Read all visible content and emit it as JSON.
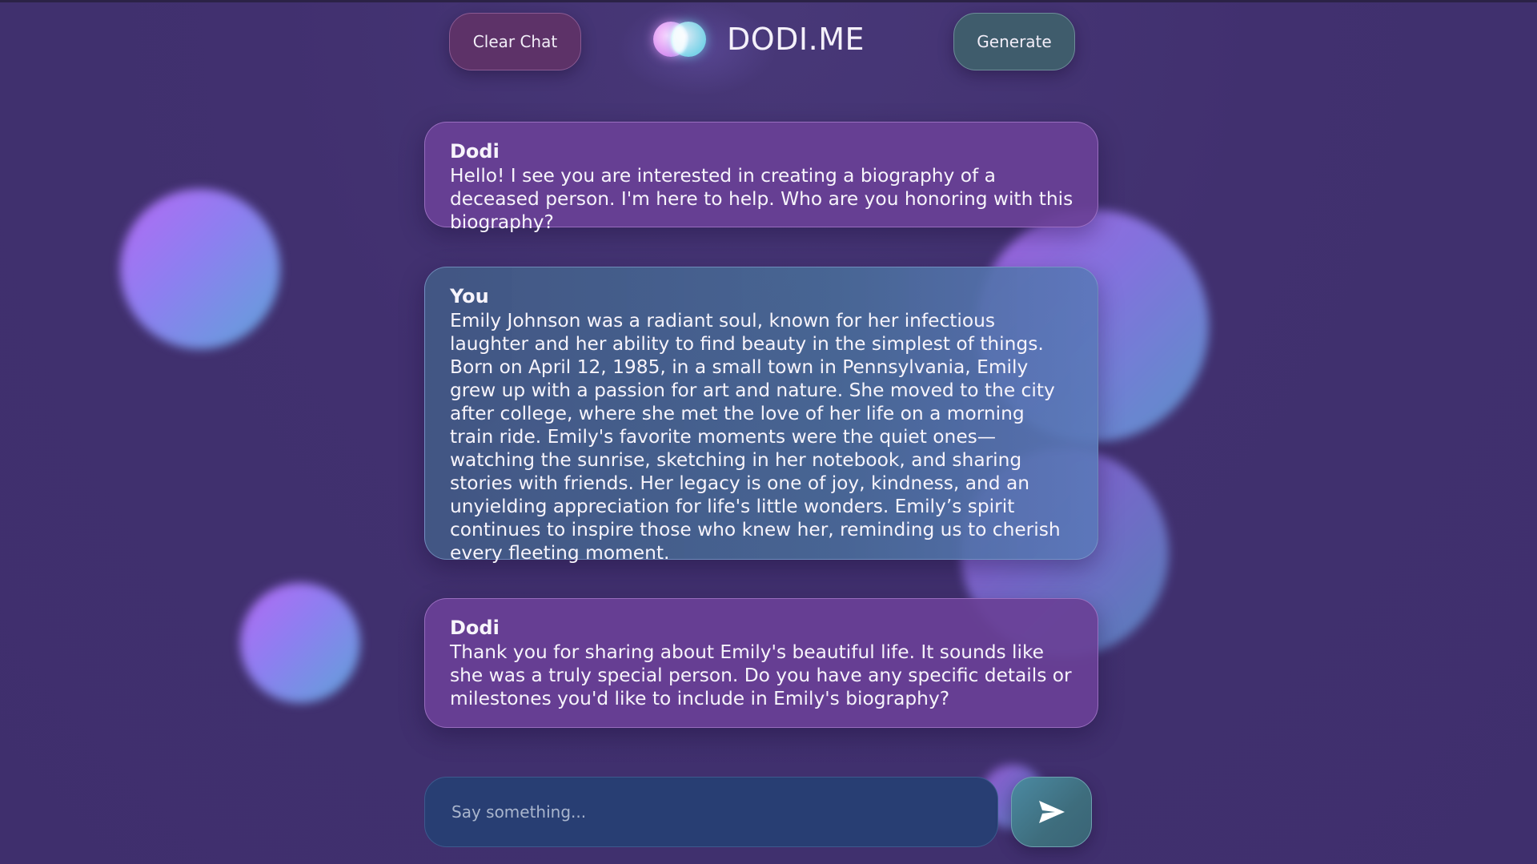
{
  "header": {
    "clear_label": "Clear Chat",
    "brand": "DODI.ME",
    "generate_label": "Generate"
  },
  "messages": [
    {
      "author": "Dodi",
      "text": "Hello! I see you are interested in creating a biography of a deceased person. I'm here to help. Who are you honoring with this biography?"
    },
    {
      "author": "You",
      "text": "Emily Johnson was a radiant soul, known for her infectious laughter and her ability to find beauty in the simplest of things. Born on April 12, 1985, in a small town in Pennsylvania, Emily grew up with a passion for art and nature. She moved to the city after college, where she met the love of her life on a morning train ride. Emily's favorite moments were the quiet ones—watching the sunrise, sketching in her notebook, and sharing stories with friends. Her legacy is one of joy, kindness, and an unyielding appreciation for life's little wonders. Emily’s spirit continues to inspire those who knew her, reminding us to cherish every fleeting moment."
    },
    {
      "author": "Dodi",
      "text": "Thank you for sharing about Emily's beautiful life. It sounds like she was a truly special person. Do you have any specific details or milestones you'd like to include in Emily's biography?"
    }
  ],
  "composer": {
    "placeholder": "Say something...",
    "value": ""
  },
  "icons": {
    "logo": "dodi-logo-icon",
    "send": "send-icon"
  },
  "colors": {
    "background": "#40306f",
    "dodi_bubble": "#694096",
    "user_bubble": "#425884",
    "clear_button": "#5d3268",
    "generate_button": "#3f5c6c",
    "input": "#283e73"
  }
}
